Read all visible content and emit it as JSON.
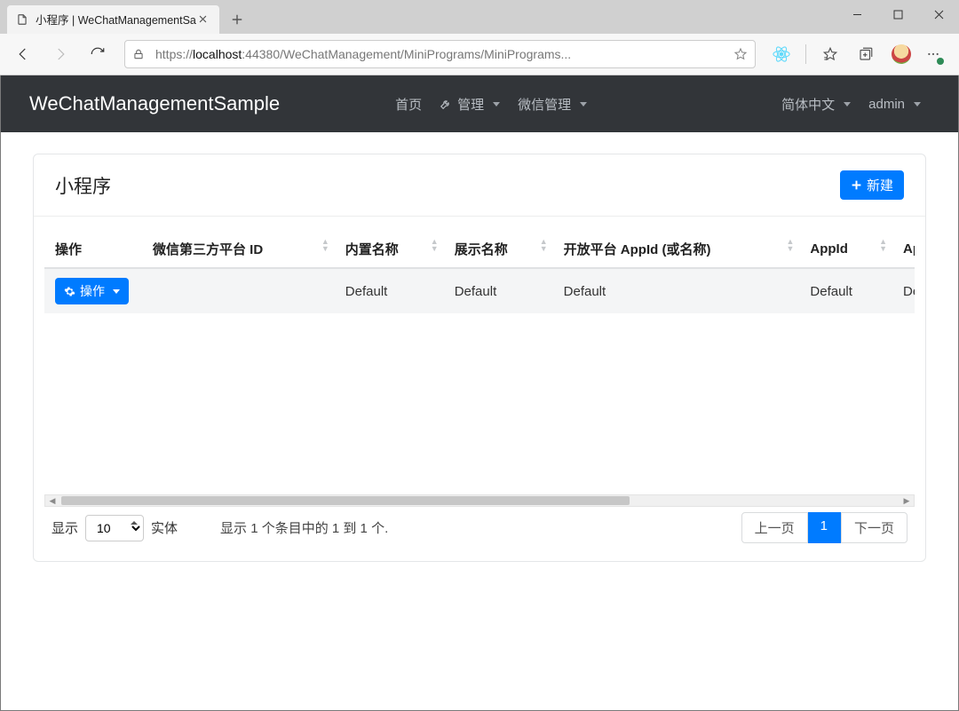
{
  "browser": {
    "tab_title": "小程序 | WeChatManagementSa",
    "url_pre": "https://",
    "url_host": "localhost",
    "url_rest": ":44380/WeChatManagement/MiniPrograms/MiniPrograms..."
  },
  "navbar": {
    "brand": "WeChatManagementSample",
    "home": "首页",
    "manage": "管理",
    "wechat_manage": "微信管理",
    "language": "简体中文",
    "user": "admin"
  },
  "page": {
    "title": "小程序",
    "new_button": "新建"
  },
  "table": {
    "columns": {
      "actions": "操作",
      "third_party_platform_id": "微信第三方平台 ID",
      "builtin_name": "内置名称",
      "display_name": "展示名称",
      "open_platform_appid": "开放平台 AppId (或名称)",
      "appid": "AppId",
      "appsecret": "AppSecret"
    },
    "rows": [
      {
        "action_label": "操作",
        "third_party_platform_id": "",
        "builtin_name": "Default",
        "display_name": "Default",
        "open_platform_appid": "Default",
        "appid": "Default",
        "appsecret": "Default"
      }
    ]
  },
  "footer": {
    "show_label": "显示",
    "page_size": "10",
    "entities_label": "实体",
    "info": "显示 1 个条目中的 1 到 1 个.",
    "prev": "上一页",
    "page": "1",
    "next": "下一页"
  }
}
